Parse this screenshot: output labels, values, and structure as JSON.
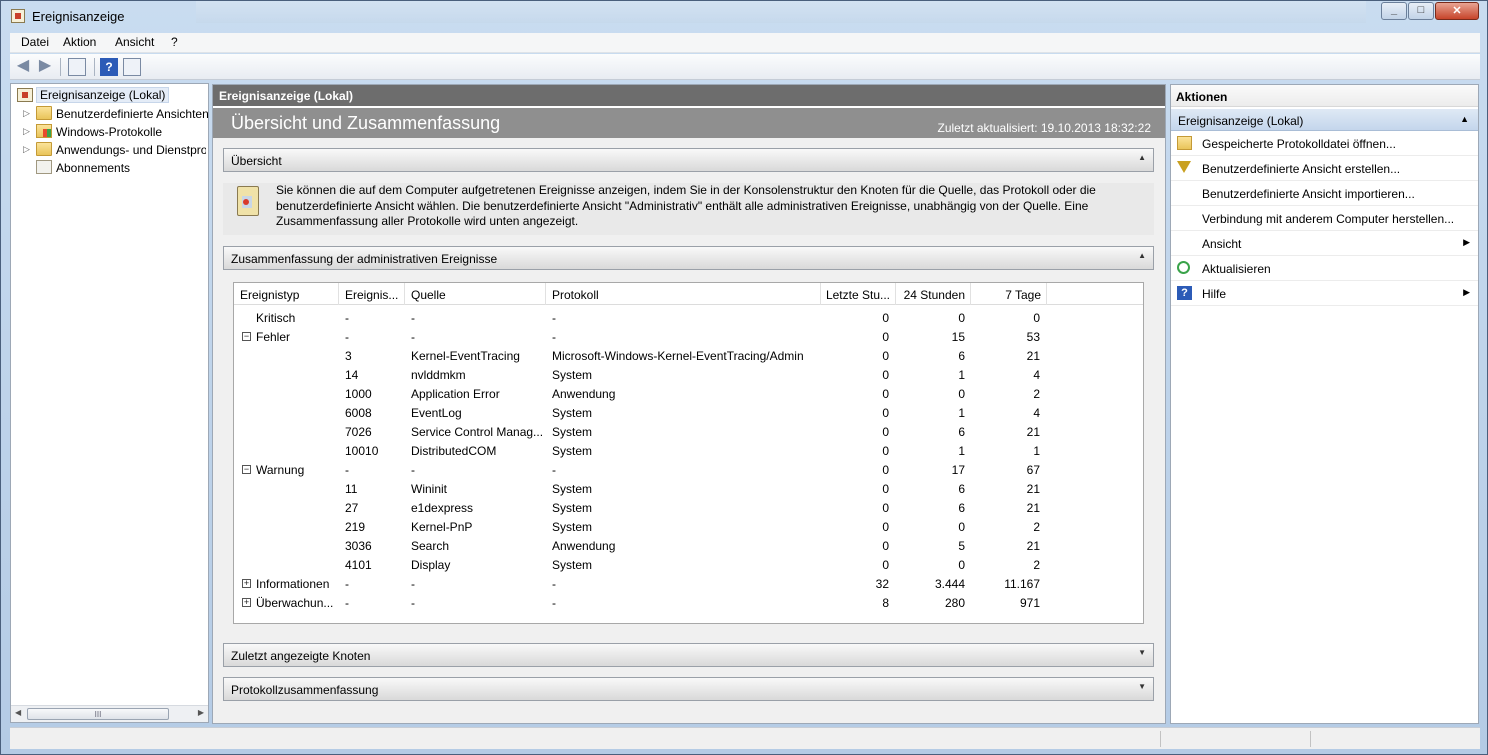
{
  "window": {
    "title": "Ereignisanzeige"
  },
  "menu": [
    "Datei",
    "Aktion",
    "Ansicht",
    "?"
  ],
  "toolbar": {
    "icons": [
      "back-icon",
      "forward-icon",
      "show-hide-tree-icon",
      "help-icon",
      "show-hide-action-pane-icon"
    ]
  },
  "tree": {
    "root": "Ereignisanzeige (Lokal)",
    "items": [
      {
        "label": "Benutzerdefinierte Ansichten",
        "expandable": true
      },
      {
        "label": "Windows-Protokolle",
        "expandable": true
      },
      {
        "label": "Anwendungs- und Dienstprotokolle",
        "expandable": true
      },
      {
        "label": "Abonnements",
        "expandable": false
      }
    ],
    "scroll_thumb": "III"
  },
  "center": {
    "header": "Ereignisanzeige (Lokal)",
    "title": "Übersicht und Zusammenfassung",
    "updated": "Zuletzt aktualisiert: 19.10.2013 18:32:22",
    "sections": {
      "overview": "Übersicht",
      "overview_text": "Sie können die auf dem Computer aufgetretenen Ereignisse anzeigen, indem Sie in der Konsolenstruktur den Knoten für die Quelle, das Protokoll oder die benutzerdefinierte Ansicht wählen. Die benutzerdefinierte Ansicht \"Administrativ\" enthält alle administrativen Ereignisse, unabhängig von der Quelle. Eine Zusammenfassung aller Protokolle wird unten angezeigt.",
      "summary": "Zusammenfassung der administrativen Ereignisse",
      "recent": "Zuletzt angezeigte Knoten",
      "log_summary": "Protokollzusammenfassung"
    },
    "table": {
      "columns": [
        "Ereignistyp",
        "Ereignis...",
        "Quelle",
        "Protokoll",
        "Letzte Stu...",
        "24 Stunden",
        "7 Tage"
      ],
      "rows": [
        {
          "type": "Kritisch",
          "toggle": "",
          "id": "-",
          "source": "-",
          "log": "-",
          "h1": "0",
          "h24": "0",
          "d7": "0"
        },
        {
          "type": "Fehler",
          "toggle": "−",
          "id": "-",
          "source": "-",
          "log": "-",
          "h1": "0",
          "h24": "15",
          "d7": "53"
        },
        {
          "type": "",
          "toggle": "",
          "id": "3",
          "source": "Kernel-EventTracing",
          "log": "Microsoft-Windows-Kernel-EventTracing/Admin",
          "h1": "0",
          "h24": "6",
          "d7": "21"
        },
        {
          "type": "",
          "toggle": "",
          "id": "14",
          "source": "nvlddmkm",
          "log": "System",
          "h1": "0",
          "h24": "1",
          "d7": "4"
        },
        {
          "type": "",
          "toggle": "",
          "id": "1000",
          "source": "Application Error",
          "log": "Anwendung",
          "h1": "0",
          "h24": "0",
          "d7": "2"
        },
        {
          "type": "",
          "toggle": "",
          "id": "6008",
          "source": "EventLog",
          "log": "System",
          "h1": "0",
          "h24": "1",
          "d7": "4"
        },
        {
          "type": "",
          "toggle": "",
          "id": "7026",
          "source": "Service Control Manag...",
          "log": "System",
          "h1": "0",
          "h24": "6",
          "d7": "21"
        },
        {
          "type": "",
          "toggle": "",
          "id": "10010",
          "source": "DistributedCOM",
          "log": "System",
          "h1": "0",
          "h24": "1",
          "d7": "1"
        },
        {
          "type": "Warnung",
          "toggle": "−",
          "id": "-",
          "source": "-",
          "log": "-",
          "h1": "0",
          "h24": "17",
          "d7": "67"
        },
        {
          "type": "",
          "toggle": "",
          "id": "11",
          "source": "Wininit",
          "log": "System",
          "h1": "0",
          "h24": "6",
          "d7": "21"
        },
        {
          "type": "",
          "toggle": "",
          "id": "27",
          "source": "e1dexpress",
          "log": "System",
          "h1": "0",
          "h24": "6",
          "d7": "21"
        },
        {
          "type": "",
          "toggle": "",
          "id": "219",
          "source": "Kernel-PnP",
          "log": "System",
          "h1": "0",
          "h24": "0",
          "d7": "2"
        },
        {
          "type": "",
          "toggle": "",
          "id": "3036",
          "source": "Search",
          "log": "Anwendung",
          "h1": "0",
          "h24": "5",
          "d7": "21"
        },
        {
          "type": "",
          "toggle": "",
          "id": "4101",
          "source": "Display",
          "log": "System",
          "h1": "0",
          "h24": "0",
          "d7": "2"
        },
        {
          "type": "Informationen",
          "toggle": "+",
          "id": "-",
          "source": "-",
          "log": "-",
          "h1": "32",
          "h24": "3.444",
          "d7": "11.167"
        },
        {
          "type": "Überwachun...",
          "toggle": "+",
          "id": "-",
          "source": "-",
          "log": "-",
          "h1": "8",
          "h24": "280",
          "d7": "971"
        }
      ]
    }
  },
  "actions": {
    "header": "Aktionen",
    "group": "Ereignisanzeige (Lokal)",
    "items": [
      {
        "label": "Gespeicherte Protokolldatei öffnen...",
        "icon": "open-folder-icon",
        "submenu": false
      },
      {
        "label": "Benutzerdefinierte Ansicht erstellen...",
        "icon": "filter-icon",
        "submenu": false
      },
      {
        "label": "Benutzerdefinierte Ansicht importieren...",
        "icon": "",
        "submenu": false
      },
      {
        "label": "Verbindung mit anderem Computer herstellen...",
        "icon": "",
        "submenu": false
      },
      {
        "label": "Ansicht",
        "icon": "",
        "submenu": true
      },
      {
        "label": "Aktualisieren",
        "icon": "refresh-icon",
        "submenu": false
      },
      {
        "label": "Hilfe",
        "icon": "help-icon",
        "submenu": true
      }
    ]
  }
}
